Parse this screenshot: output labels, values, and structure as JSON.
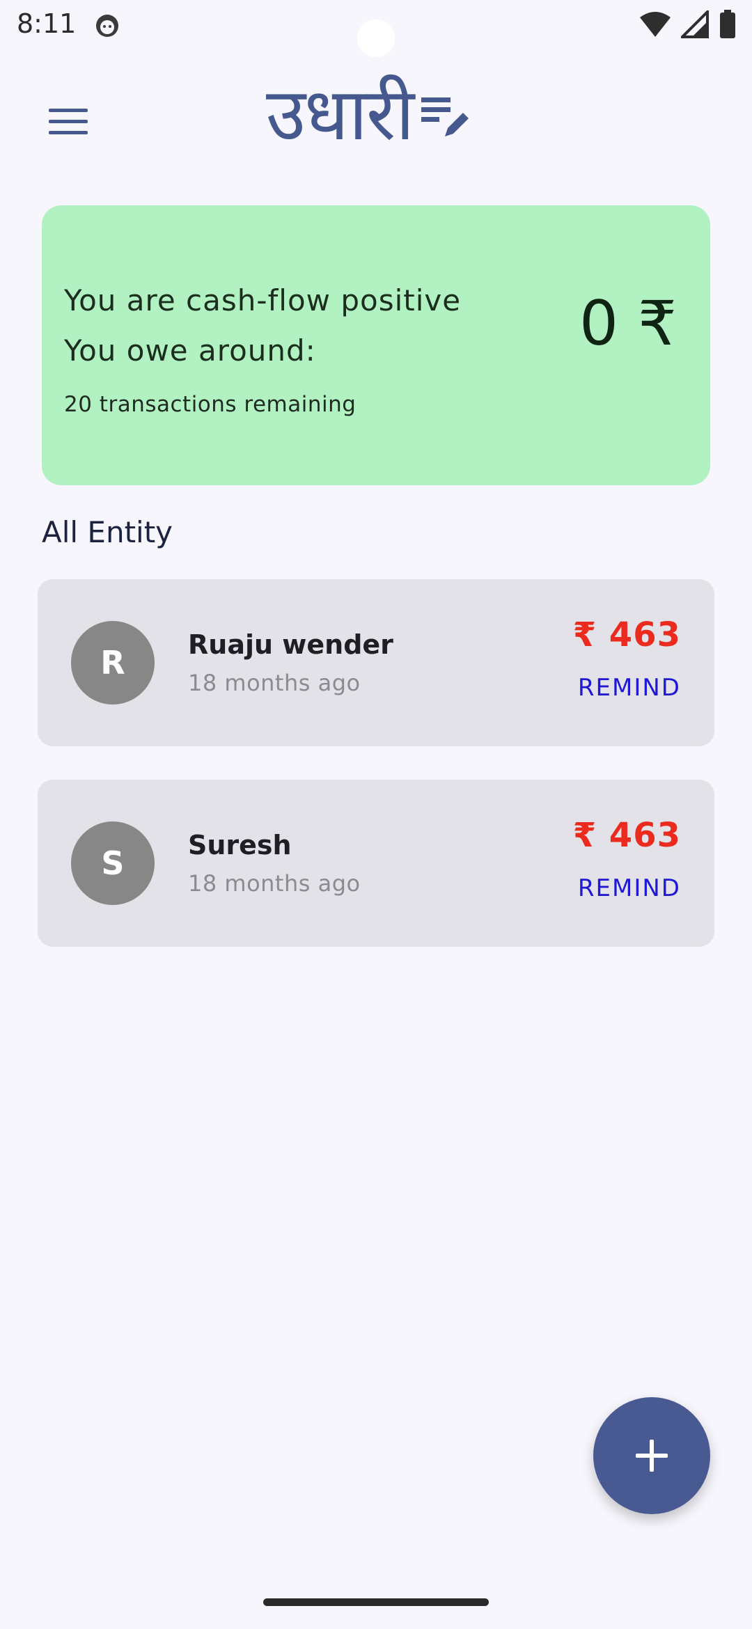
{
  "status_bar": {
    "time": "8:11",
    "icons": [
      "cat-notification-icon",
      "wifi-icon",
      "cellular-signal-icon",
      "battery-icon"
    ]
  },
  "app_bar": {
    "logo_text": "उधारी",
    "logo_icon": "list-edit-icon",
    "menu_icon": "hamburger-menu-icon"
  },
  "summary": {
    "line1": "You are cash-flow positive",
    "line2": "You owe around:",
    "remaining": "20 transactions remaining",
    "amount": "0 ₹",
    "background_color": "#b2f1c2"
  },
  "section": {
    "title": "All Entity"
  },
  "entities": [
    {
      "initial": "R",
      "name": "Ruaju wender",
      "time": "18 months ago",
      "amount": "₹ 463",
      "action": "REMIND"
    },
    {
      "initial": "S",
      "name": "Suresh",
      "time": "18 months ago",
      "amount": "₹ 463",
      "action": "REMIND"
    }
  ],
  "colors": {
    "primary": "#485a91",
    "amount_red": "#ec2b1f",
    "remind_blue": "#1f19d6"
  },
  "fab": {
    "icon": "plus-icon"
  }
}
